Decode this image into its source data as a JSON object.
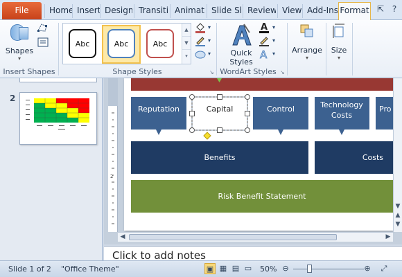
{
  "tabs": {
    "file": "File",
    "items": [
      "Home",
      "Insert",
      "Design",
      "Transiti",
      "Animati",
      "Slide Sh",
      "Review",
      "View",
      "Add-Ins",
      "Format"
    ],
    "active": "Format"
  },
  "ribbon": {
    "insert_shapes": {
      "shapes_label": "Shapes",
      "group_label": "Insert Shapes"
    },
    "shape_styles": {
      "swatches": [
        "Abc",
        "Abc",
        "Abc"
      ],
      "group_label": "Shape Styles"
    },
    "wordart_styles": {
      "quick_styles_label": "Quick Styles",
      "group_label": "WordArt Styles"
    },
    "arrange": {
      "label": "Arrange"
    },
    "size": {
      "label": "Size"
    }
  },
  "slides_panel": {
    "slide_number": "2"
  },
  "slide": {
    "boxes_row1": [
      "Reputation",
      "Capital",
      "Control",
      "Technology Costs",
      "Pro"
    ],
    "benefits": "Benefits",
    "costs": "Costs",
    "risk_statement": "Risk Benefit Statement"
  },
  "notes": {
    "placeholder": "Click to add notes"
  },
  "status": {
    "slide_info": "Slide 1 of 2",
    "theme": "\"Office Theme\"",
    "zoom": "50%"
  },
  "colors": {
    "title_bar_red": "#983833",
    "chevron_blue": "#3c6190",
    "dark_blue": "#1f3b63",
    "green": "#72903a",
    "file_tab": "#d9541e"
  }
}
